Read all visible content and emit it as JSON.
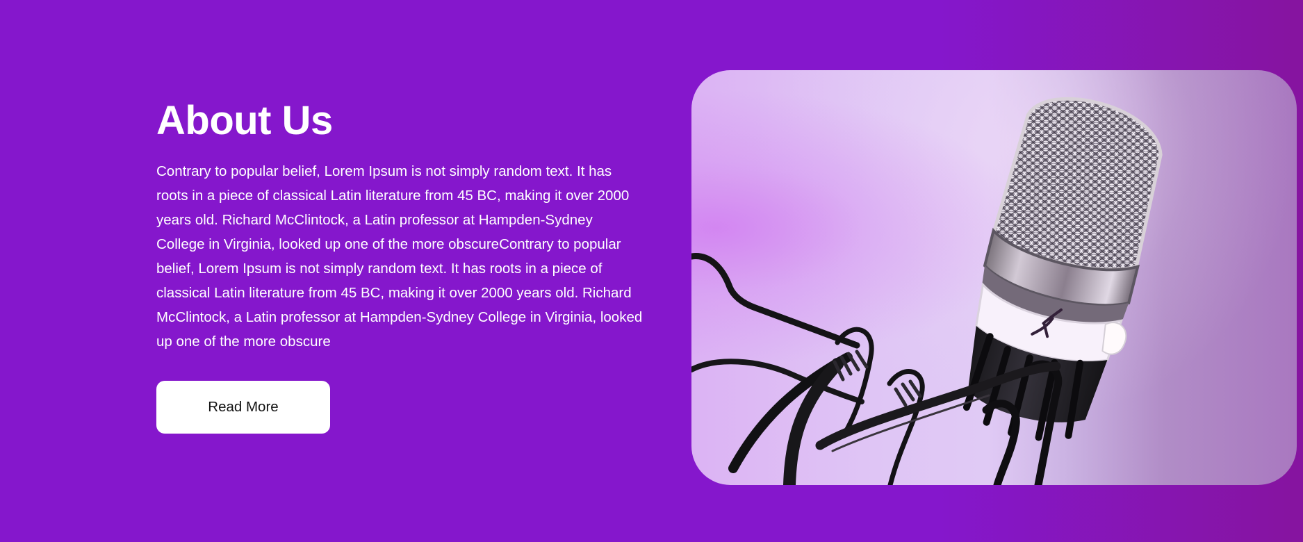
{
  "about": {
    "title": "About Us",
    "description": "Contrary to popular belief, Lorem Ipsum is not simply random text. It has roots in a piece of classical Latin literature from 45 BC, making it over 2000 years old. Richard McClintock, a Latin professor at Hampden-Sydney College in Virginia, looked up one of the more obscureContrary to popular belief, Lorem Ipsum is not simply random text. It has roots in a piece of classical Latin literature from 45 BC, making it over 2000 years old. Richard McClintock, a Latin professor at Hampden-Sydney College in Virginia, looked up one of the more obscure",
    "button_label": "Read More"
  },
  "colors": {
    "background": "#8517cc",
    "background_edge": "#86149f",
    "text": "#ffffff",
    "button_background": "#ffffff",
    "button_text": "#111111"
  },
  "icons": {
    "photo": "microphone-icon"
  }
}
